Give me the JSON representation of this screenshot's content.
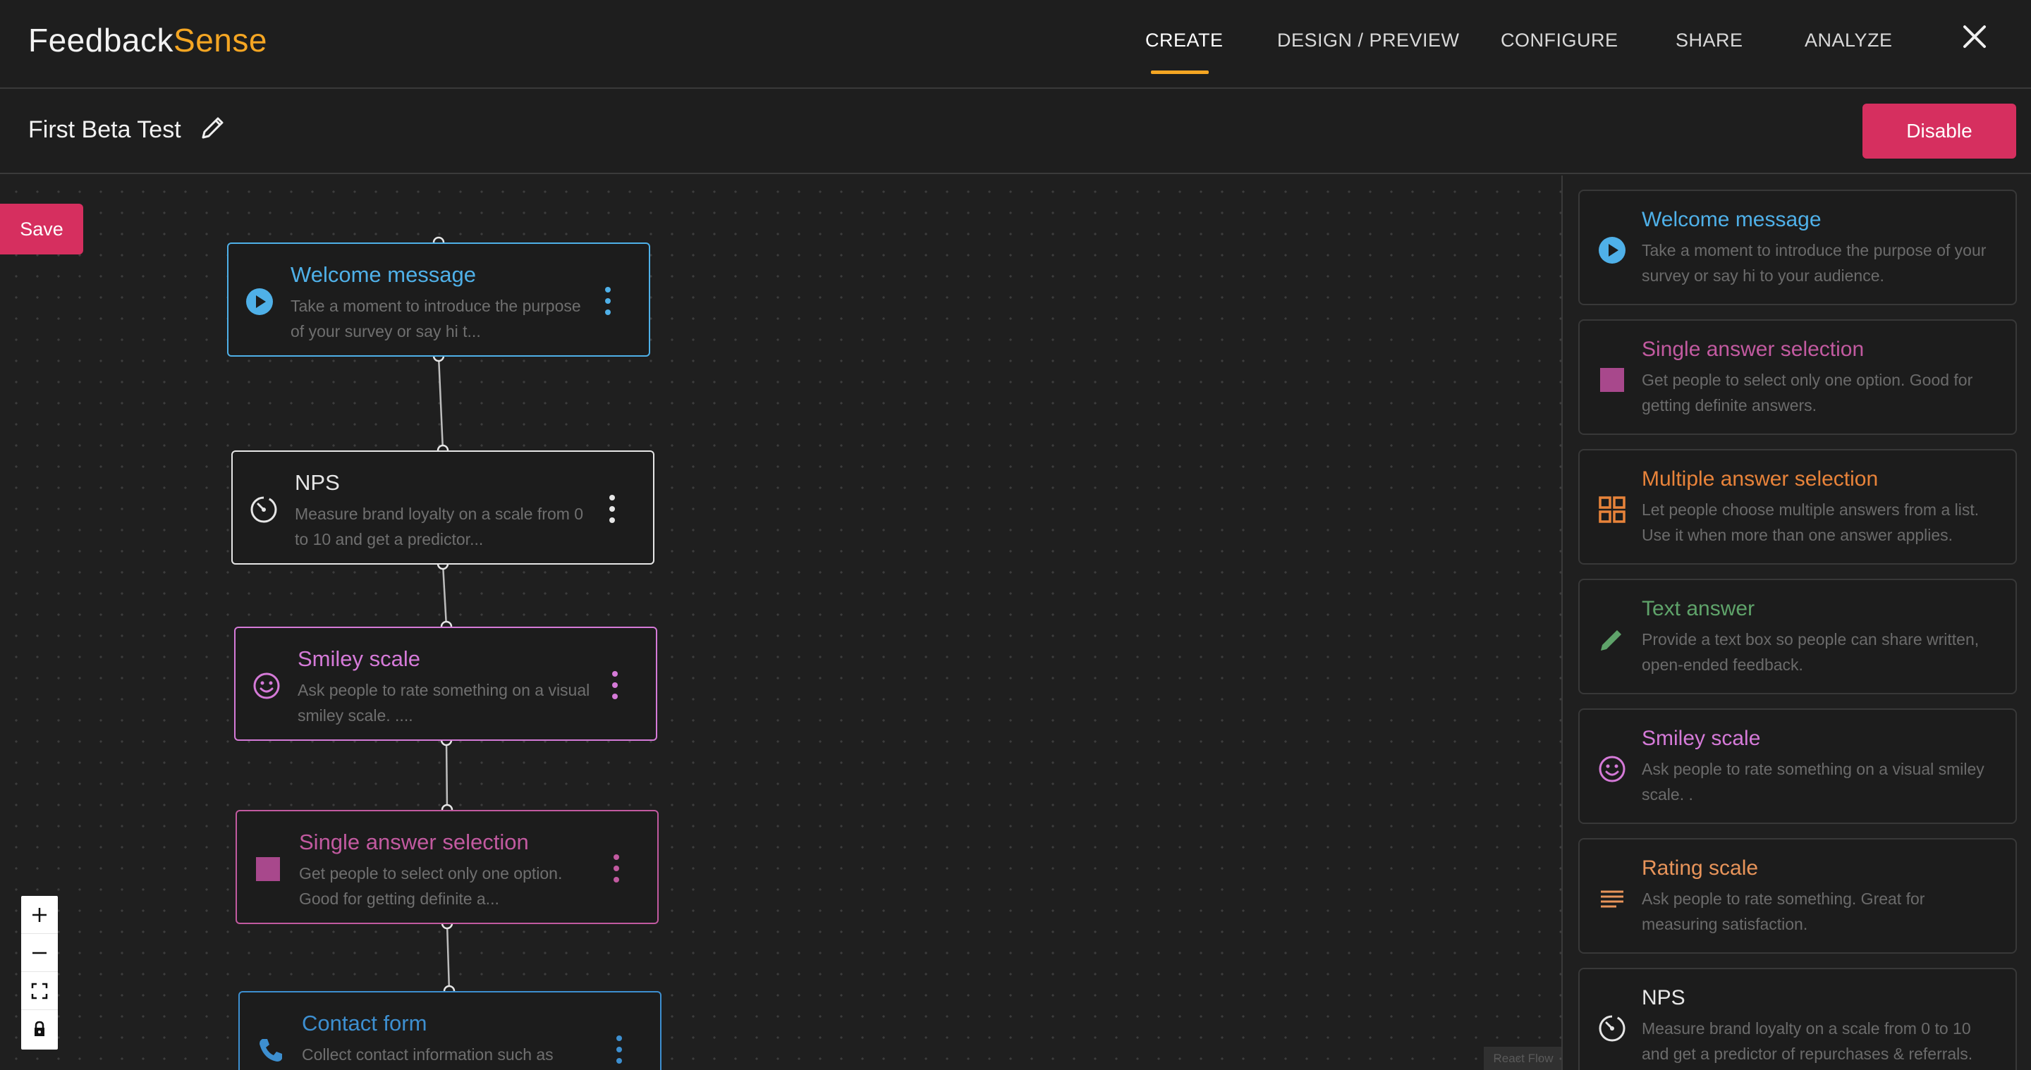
{
  "brand": {
    "part1": "Feedback",
    "part2": "Sense"
  },
  "nav": {
    "tabs": [
      {
        "label": "CREATE",
        "active": true
      },
      {
        "label": "DESIGN / PREVIEW",
        "active": false
      },
      {
        "label": "CONFIGURE",
        "active": false
      },
      {
        "label": "SHARE",
        "active": false
      },
      {
        "label": "ANALYZE",
        "active": false
      }
    ]
  },
  "survey": {
    "title": "First Beta Test",
    "disable_label": "Disable"
  },
  "canvas": {
    "save_label": "Save",
    "attribution": "React Flow",
    "nodes": [
      {
        "title": "Welcome message",
        "desc": "Take a moment to introduce the purpose of your survey or say hi t...",
        "color": "#4fb0e8",
        "icon": "play-circle-icon"
      },
      {
        "title": "NPS",
        "desc": "Measure brand loyalty on a scale from 0 to 10 and get a predictor...",
        "color": "#e6e6e6",
        "icon": "speedometer-icon"
      },
      {
        "title": "Smiley scale",
        "desc": "Ask people to rate something on a visual smiley scale. ....",
        "color": "#d57ad8",
        "icon": "smiley-icon"
      },
      {
        "title": "Single answer selection",
        "desc": "Get people to select only one option. Good for getting definite a...",
        "color": "#c25aa0",
        "icon": "square-icon"
      },
      {
        "title": "Contact form",
        "desc": "Collect contact information such as",
        "color": "#3d8fd0",
        "icon": "phone-icon"
      }
    ]
  },
  "palette": {
    "items": [
      {
        "title": "Welcome message",
        "desc": "Take a moment to introduce the purpose of your survey or say hi to your audience.",
        "color": "#4fb0e8",
        "icon": "play-circle-icon"
      },
      {
        "title": "Single answer selection",
        "desc": "Get people to select only one option. Good for getting definite answers.",
        "color": "#c25aa0",
        "icon": "square-icon"
      },
      {
        "title": "Multiple answer selection",
        "desc": "Let people choose multiple answers from a list. Use it when more than one answer applies.",
        "color": "#e8833a",
        "icon": "grid-icon"
      },
      {
        "title": "Text answer",
        "desc": "Provide a text box so people can share written, open-ended feedback.",
        "color": "#5fa36a",
        "icon": "pencil-icon"
      },
      {
        "title": "Smiley scale",
        "desc": "Ask people to rate something on a visual smiley scale. .",
        "color": "#d57ad8",
        "icon": "smiley-icon"
      },
      {
        "title": "Rating scale",
        "desc": "Ask people to rate something. Great for measuring satisfaction.",
        "color": "#e8945a",
        "icon": "lines-icon"
      },
      {
        "title": "NPS",
        "desc": "Measure brand loyalty on a scale from 0 to 10 and get a predictor of repurchases & referrals.",
        "color": "#e6e6e6",
        "icon": "speedometer-icon"
      }
    ]
  }
}
